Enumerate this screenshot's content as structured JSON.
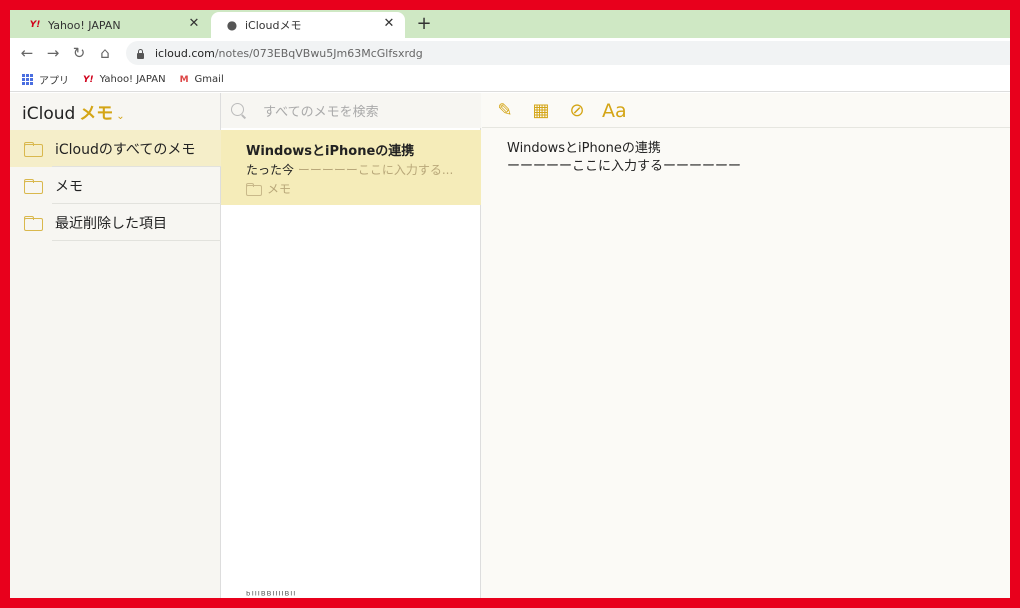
{
  "browser": {
    "tabs": [
      {
        "title": "Yahoo! JAPAN",
        "favicon": "yahoo-icon",
        "active": false
      },
      {
        "title": "iCloudメモ",
        "favicon": "apple-icon",
        "active": true
      }
    ],
    "close_glyph": "✕",
    "new_tab_glyph": "+",
    "url_host": "icloud.com",
    "url_path": "/notes/073EBqVBwu5Jm63McGlfsxrdg",
    "bookmarks": [
      {
        "label": "アプリ",
        "icon": "apps-grid-icon"
      },
      {
        "label": "Yahoo! JAPAN",
        "icon": "yahoo-icon"
      },
      {
        "label": "Gmail",
        "icon": "gmail-icon"
      }
    ],
    "tab_bar_color": "#cfe8c4"
  },
  "app": {
    "title_prefix": "iCloud",
    "title_app": "メモ",
    "accent_color": "#d4a516",
    "folders": [
      {
        "label": "iCloudのすべてのメモ",
        "selected": true
      },
      {
        "label": "メモ",
        "selected": false
      },
      {
        "label": "最近削除した項目",
        "selected": false
      }
    ],
    "search_placeholder": "すべてのメモを検索",
    "notes": [
      {
        "title": "WindowsとiPhoneの連携",
        "time": "たった今",
        "preview": "ーーーーーここに入力する...",
        "folder": "メモ"
      }
    ],
    "bottom_cut_text": "ᵇᴵᴵᴵᴮᴮᴵᴵᴵᴵᴮᴵᴵ",
    "editor": {
      "line1": "WindowsとiPhoneの連携",
      "line2": "ーーーーーここに入力するーーーーーー"
    }
  }
}
